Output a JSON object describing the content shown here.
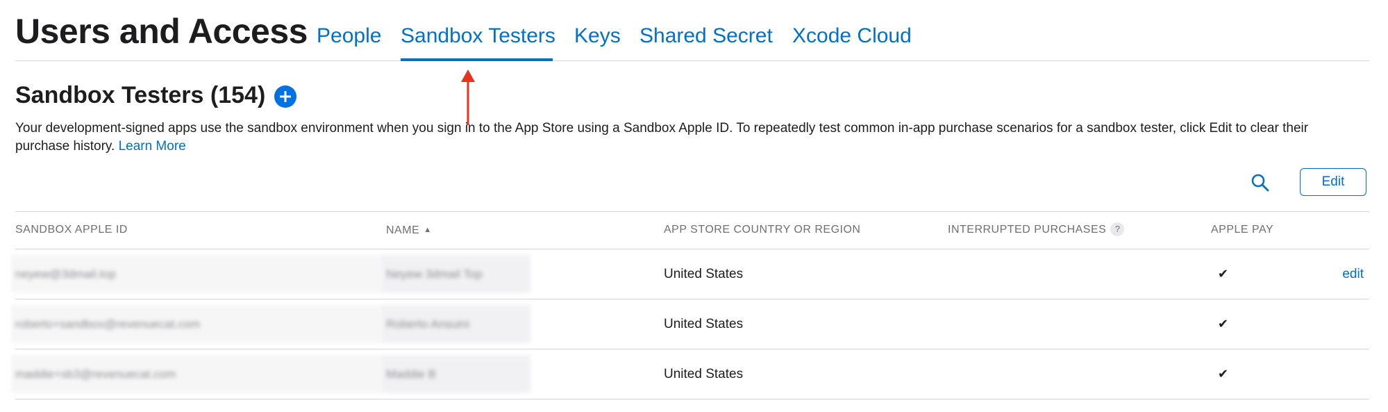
{
  "header": {
    "title": "Users and Access",
    "tabs": [
      {
        "label": "People"
      },
      {
        "label": "Sandbox Testers",
        "active": true
      },
      {
        "label": "Keys"
      },
      {
        "label": "Shared Secret"
      },
      {
        "label": "Xcode Cloud"
      }
    ]
  },
  "section": {
    "title": "Sandbox Testers (154)",
    "add_icon": "plus-circle-icon",
    "description": "Your development-signed apps use the sandbox environment when you sign in to the App Store using a Sandbox Apple ID. To repeatedly test common in-app purchase scenarios for a sandbox tester, click Edit to clear their purchase history. ",
    "learn_more": "Learn More"
  },
  "toolbar": {
    "search_icon": "search-icon",
    "edit_label": "Edit"
  },
  "table": {
    "columns": {
      "apple_id": "SANDBOX APPLE ID",
      "name": "NAME",
      "country": "APP STORE COUNTRY OR REGION",
      "interrupted": "INTERRUPTED PURCHASES",
      "apple_pay": "APPLE PAY"
    },
    "sort_indicator": "▲",
    "help_glyph": "?",
    "rows": [
      {
        "apple_id": "neyew@3dmail.top",
        "name": "Neyew 3dmail Top",
        "country": "United States",
        "interrupted": "",
        "apple_pay": "✔",
        "action": "edit"
      },
      {
        "apple_id": "roberto+sandbox@revenuecat.com",
        "name": "Roberto Ansuini",
        "country": "United States",
        "interrupted": "",
        "apple_pay": "✔",
        "action": ""
      },
      {
        "apple_id": "maddie+sb3@revenuecat.com",
        "name": "Maddie B",
        "country": "United States",
        "interrupted": "",
        "apple_pay": "✔",
        "action": ""
      }
    ]
  },
  "colors": {
    "accent": "#0070c9",
    "annotation": "#e8321f",
    "divider": "#d2d2d7"
  }
}
